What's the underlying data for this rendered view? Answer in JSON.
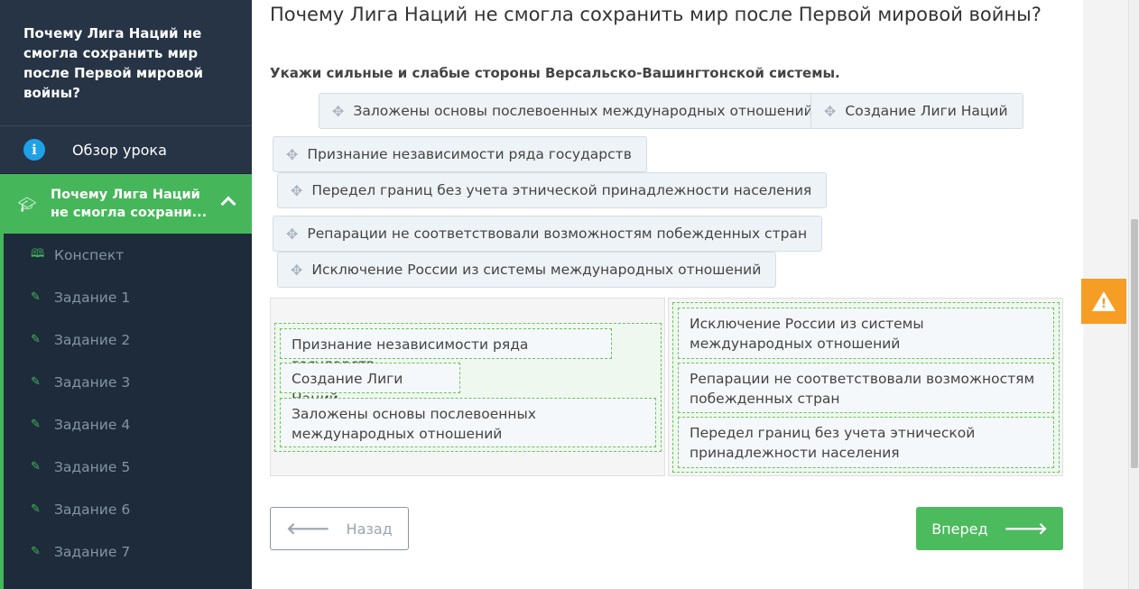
{
  "sidebar": {
    "lesson_title": "Почему Лига Наций не смогла сохранить мир после Первой мировой войны?",
    "overview_label": "Обзор урока",
    "active_label_line1": "Почему Лига Наций",
    "active_label_line2": "не смогла сохрани...",
    "items": [
      {
        "label": "Конспект",
        "icon": "book-icon"
      },
      {
        "label": "Задание 1",
        "icon": "edit-icon"
      },
      {
        "label": "Задание 2",
        "icon": "edit-icon"
      },
      {
        "label": "Задание 3",
        "icon": "edit-icon"
      },
      {
        "label": "Задание 4",
        "icon": "edit-icon"
      },
      {
        "label": "Задание 5",
        "icon": "edit-icon"
      },
      {
        "label": "Задание 6",
        "icon": "edit-icon"
      },
      {
        "label": "Задание 7",
        "icon": "edit-icon"
      }
    ]
  },
  "main": {
    "page_title": "Почему Лига Наций не смогла сохранить мир после Первой мировой войны?",
    "instruction": "Укажи сильные и слабые стороны Версальско-Вашингтонской системы.",
    "options": [
      "Заложены основы послевоенных международных отношений",
      "Создание Лиги Наций",
      "Признание независимости ряда государств",
      "Передел границ без учета этнической принадлежности населения",
      "Репарации не соответствовали возможностям побежденных стран",
      "Исключение России из системы международных отношений"
    ],
    "left_zone": [
      "Признание независимости ряда государств",
      "Создание Лиги Наций",
      "Заложены основы послевоенных международных отношений"
    ],
    "right_zone": [
      "Исключение России из системы международных отношений",
      "Репарации не соответствовали возможностям побежденных стран",
      "Передел границ без учета этнической принадлежности населения"
    ],
    "back_label": "Назад",
    "next_label": "Вперед"
  },
  "colors": {
    "sidebar_bg": "#1e2b3b",
    "accent_green": "#45b75a",
    "warning_orange": "#f59d24",
    "info_blue": "#1ea1e6"
  }
}
